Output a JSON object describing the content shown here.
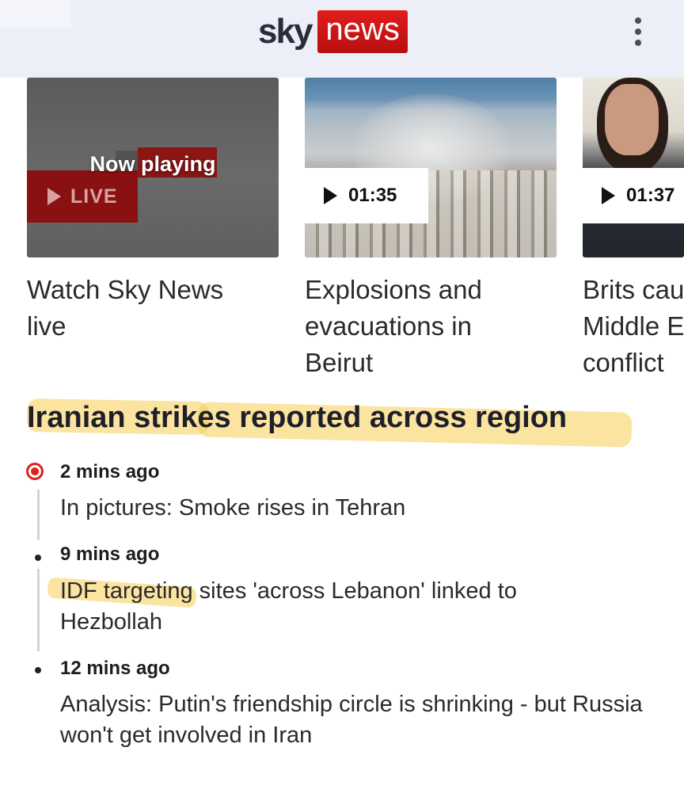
{
  "header": {
    "logo_sky": "sky",
    "logo_news": "news",
    "menu_icon": "vertical-dots-icon",
    "brand_color": "#d31515"
  },
  "carousel": [
    {
      "overlay": "Now playing",
      "badge": "LIVE",
      "title": "Watch Sky News live"
    },
    {
      "duration": "01:35",
      "title": "Explosions and evacuations in Beirut"
    },
    {
      "duration": "01:37",
      "title": "Brits cau\nMiddle E\nconflict"
    }
  ],
  "headline": "Iranian strikes reported across region",
  "timeline": [
    {
      "time": "2 mins ago",
      "text": "In pictures: Smoke rises in Tehran",
      "live": true
    },
    {
      "time": "9 mins ago",
      "text": "IDF targeting sites 'across Lebanon' linked to Hezbollah"
    },
    {
      "time": "12 mins ago",
      "text": "Analysis: Putin's friendship circle is shrinking - but Russia won't get involved in Iran"
    }
  ]
}
